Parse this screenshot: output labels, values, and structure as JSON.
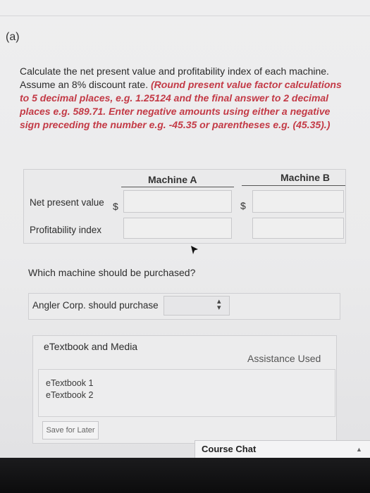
{
  "part": {
    "label": "(a)"
  },
  "instructions": {
    "plain": "Calculate the net present value and profitability index of each machine. Assume an 8% discount rate. ",
    "emphasis": "(Round present value factor calculations to 5 decimal places, e.g. 1.25124 and the final answer to 2 decimal places e.g. 589.71. Enter negative amounts using either a negative sign preceding the number e.g. -45.35 or parentheses e.g. (45.35).)"
  },
  "table": {
    "col_a": "Machine A",
    "col_b": "Machine B",
    "row_npv": "Net present value",
    "row_pi": "Profitability index",
    "currency": "$",
    "values": {
      "npv_a": "",
      "npv_b": "",
      "pi_a": "",
      "pi_b": ""
    }
  },
  "question": {
    "text": "Which machine should be purchased?",
    "label": "Angler Corp. should purchase",
    "selected": ""
  },
  "etextbook": {
    "title": "eTextbook and Media",
    "assistance": "Assistance Used",
    "links": [
      "eTextbook 1",
      "eTextbook 2"
    ],
    "save_label": "Save for Later"
  },
  "chat": {
    "label": "Course Chat"
  },
  "icons": {
    "select": "up-down-arrows-icon",
    "chat_toggle": "caret-up-icon",
    "cursor": "mouse-pointer-icon"
  },
  "colors": {
    "emphasis": "#c33a46"
  }
}
